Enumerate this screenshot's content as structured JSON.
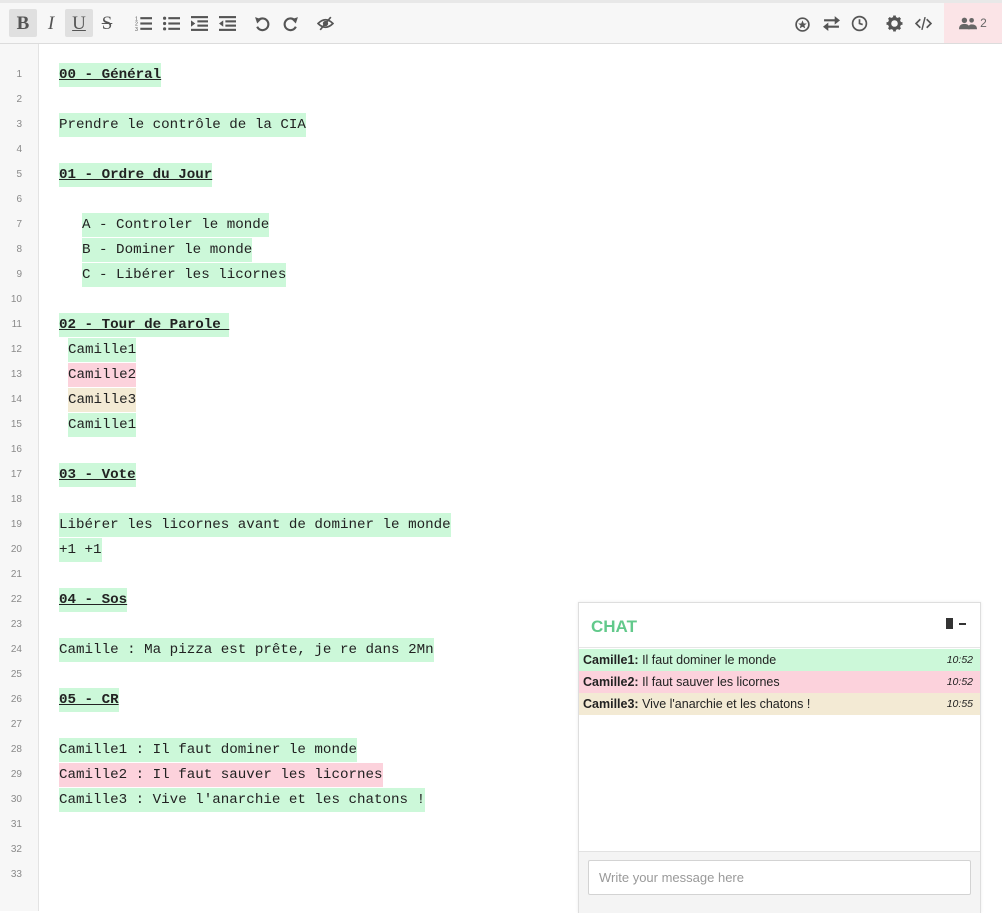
{
  "users": {
    "count": "2"
  },
  "editor": {
    "line_numbers": [
      "1",
      "2",
      "3",
      "4",
      "5",
      "6",
      "7",
      "8",
      "9",
      "10",
      "11",
      "12",
      "13",
      "14",
      "15",
      "16",
      "17",
      "18",
      "19",
      "20",
      "21",
      "22",
      "23",
      "24",
      "25",
      "26",
      "27",
      "28",
      "29",
      "30",
      "31",
      "32",
      "33"
    ],
    "lines": {
      "l1": "00 - Général",
      "l3": "Prendre le contrôle de la CIA",
      "l5": "01 - Ordre du Jour",
      "l7": "A - Controler le monde",
      "l8": "B - Dominer le monde",
      "l9": "C - Libérer les licornes",
      "l11": "02 - Tour de Parole ",
      "l12": "Camille1",
      "l13": "Camille2",
      "l14": "Camille3",
      "l15": "Camille1",
      "l17": "03 - Vote",
      "l19": "Libérer les licornes avant de dominer le monde",
      "l20": "+1 +1",
      "l22": "04 - Sos",
      "l24": "Camille : Ma pizza est prête, je re dans 2Mn",
      "l26": "05 - CR",
      "l28": "Camille1 : Il faut dominer le monde",
      "l29": "Camille2 : Il faut sauver les licornes",
      "l30": "Camille3 : Vive l'anarchie et les chatons !"
    },
    "author_colors": {
      "camille1": "#ccf8d9",
      "camille2": "#fcd2dc",
      "camille3": "#f3ead4"
    }
  },
  "chat": {
    "title": "CHAT",
    "input_placeholder": "Write your message here",
    "messages": [
      {
        "author": "Camille1:",
        "text": " Il faut dominer le monde",
        "time": "10:52"
      },
      {
        "author": "Camille2:",
        "text": " Il faut sauver les licornes",
        "time": "10:52"
      },
      {
        "author": "Camille3:",
        "text": " Vive l'anarchie et les chatons !",
        "time": "10:55"
      }
    ]
  }
}
